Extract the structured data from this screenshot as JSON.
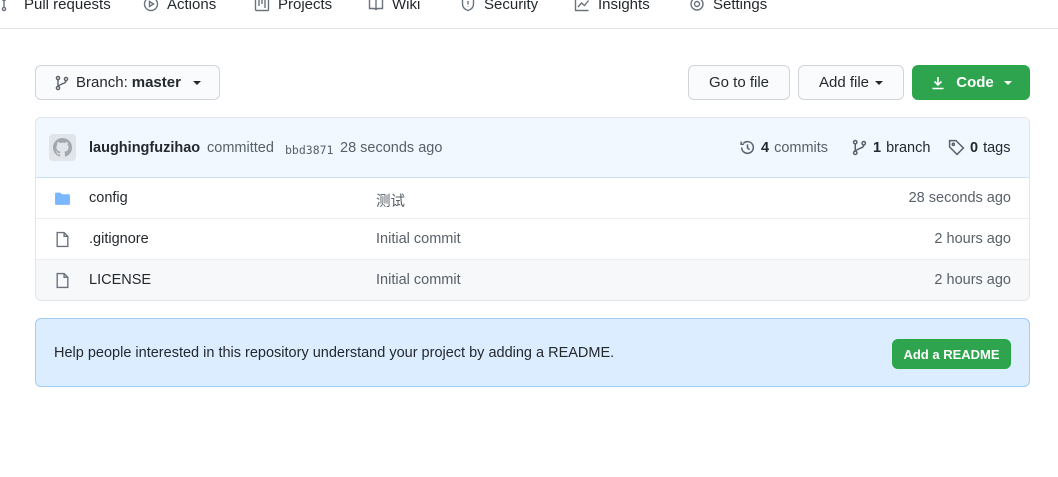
{
  "nav": {
    "tabs": [
      {
        "label": "Pull requests",
        "icon": "pull-request-icon"
      },
      {
        "label": "Actions",
        "icon": "play-icon"
      },
      {
        "label": "Projects",
        "icon": "project-icon"
      },
      {
        "label": "Wiki",
        "icon": "book-icon"
      },
      {
        "label": "Security",
        "icon": "shield-icon"
      },
      {
        "label": "Insights",
        "icon": "graph-icon"
      },
      {
        "label": "Settings",
        "icon": "gear-icon"
      }
    ]
  },
  "toolbar": {
    "branch_prefix": "Branch:",
    "branch_name": "master",
    "go_to_file": "Go to file",
    "add_file": "Add file",
    "code": "Code"
  },
  "commit": {
    "author": "laughingfuzihao",
    "verb": "committed",
    "sha": "bbd3871",
    "time": "28 seconds ago",
    "commits_count": "4",
    "commits_label": "commits",
    "branch_count": "1",
    "branch_label": "branch",
    "tags_count": "0",
    "tags_label": "tags"
  },
  "files": [
    {
      "name": "config",
      "type": "folder",
      "message": "测试",
      "age": "28 seconds ago"
    },
    {
      "name": ".gitignore",
      "type": "file",
      "message": "Initial commit",
      "age": "2 hours ago"
    },
    {
      "name": "LICENSE",
      "type": "file",
      "message": "Initial commit",
      "age": "2 hours ago"
    }
  ],
  "readme_banner": {
    "message": "Help people interested in this repository understand your project by adding a README.",
    "button": "Add a README"
  },
  "colors": {
    "primary_green": "#2ea44f",
    "folder_blue": "#79b8ff",
    "banner_bg": "#dbedff",
    "commit_bar_bg": "#f1f8ff"
  }
}
